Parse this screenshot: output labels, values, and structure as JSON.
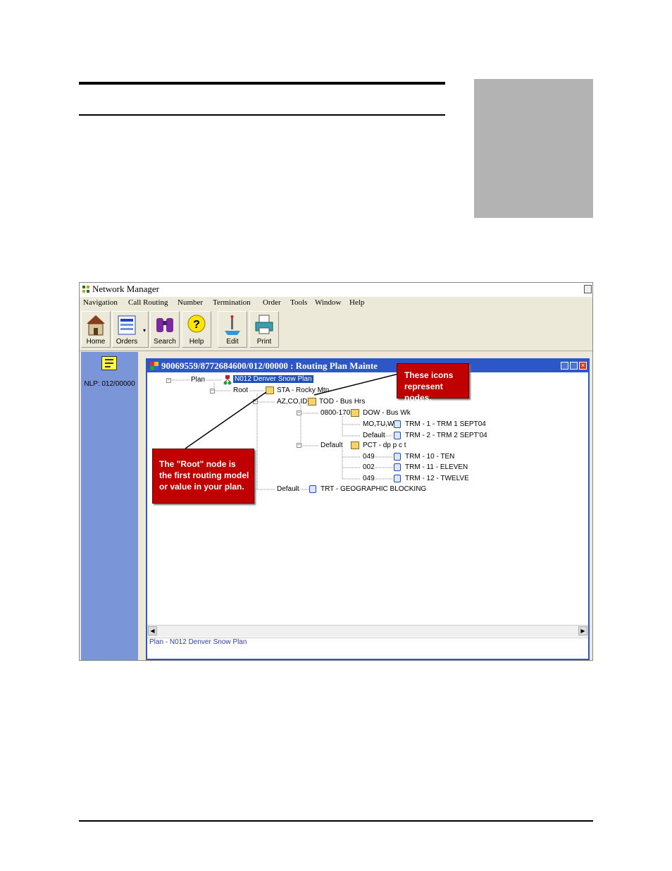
{
  "app": {
    "title": "Network Manager",
    "menu": [
      "Navigation",
      "Call Routing",
      "Number",
      "Termination",
      "Order",
      "Tools",
      "Window",
      "Help"
    ],
    "toolbar": [
      {
        "label": "Home",
        "icon": "house-icon"
      },
      {
        "label": "Orders",
        "icon": "orders-icon"
      },
      {
        "label": "Search",
        "icon": "binoculars-icon"
      },
      {
        "label": "Help",
        "icon": "help-icon"
      },
      {
        "label": "Edit",
        "icon": "edit-icon"
      },
      {
        "label": "Print",
        "icon": "printer-icon"
      }
    ],
    "left_panel": {
      "label": "NLP: 012/00000"
    }
  },
  "child_window": {
    "title": "90069559/8772684600/012/00000 : Routing Plan Mainte",
    "status": "Plan - N012   Denver Snow Plan"
  },
  "tree": {
    "plan_label": "Plan",
    "plan_value": "N012   Denver Snow Plan",
    "root_label": "Root",
    "root_value": "STA - Rocky Mtn",
    "azcoid_label": "AZ,CO,ID,",
    "azcoid_value": "TOD - Bus Hrs",
    "t0800_label": "0800-170",
    "t0800_value": "DOW - Bus Wk",
    "motuw_label": "MO,TU,W",
    "motuw_value": "TRM - 1 - TRM 1 SEPT04",
    "default1_label": "Default",
    "default1_value": "TRM - 2 - TRM 2 SEPT'04",
    "default2_label": "Default",
    "default2_value": "PCT - dp p c t",
    "p049a_label": "049",
    "p049a_value": "TRM - 10 - TEN",
    "p002_label": "002",
    "p002_value": "TRM - 11 - ELEVEN",
    "p049b_label": "049",
    "p049b_value": "TRM - 12 - TWELVE",
    "default3_label": "Default",
    "default3_value": "TRT - GEOGRAPHIC BLOCKING"
  },
  "callouts": {
    "icons": "These icons represent nodes.",
    "root": "The \"Root\" node is the first routing model or value in your plan."
  },
  "colors": {
    "title_bar": "#2d56c7",
    "callout": "#c00000",
    "left_panel": "#7b96d8",
    "sidebar_box": "#b3b3b3"
  }
}
